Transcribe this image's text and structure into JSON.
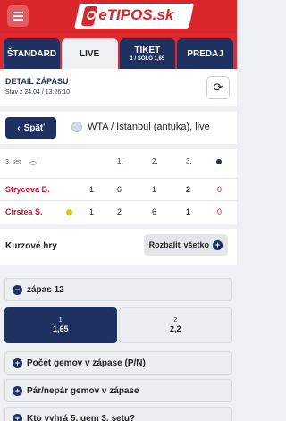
{
  "brand": {
    "logo_text": "eTIPOS.sk"
  },
  "tabs": [
    {
      "label": "ŠTANDARD",
      "sub": ""
    },
    {
      "label": "LIVE",
      "sub": ""
    },
    {
      "label": "TIKET",
      "sub": "1 / SOLO 1,65"
    },
    {
      "label": "PREDAJ",
      "sub": ""
    }
  ],
  "detail": {
    "title": "DETAIL ZÁPASU",
    "subtitle": "Stav z 24.04 / 13:26:10"
  },
  "event": {
    "back_label": "Späť",
    "title": "WTA / Istanbul (antuka), live"
  },
  "scoreboard": {
    "set_label": "3. set",
    "headers": [
      "1.",
      "2.",
      "3."
    ],
    "players": [
      {
        "name": "Strycova B.",
        "games": "1",
        "set1": "6",
        "set2": "1",
        "set3": "2",
        "points": "0",
        "serving": false
      },
      {
        "name": "Cirstea S.",
        "games": "1",
        "set1": "2",
        "set2": "6",
        "set3": "1",
        "points": "0",
        "serving": true
      }
    ]
  },
  "odds": {
    "title": "Kurzové hry",
    "expand_all_label": "Rozbaliť všetko",
    "markets": [
      {
        "label": "zápas 12",
        "expanded": true
      },
      {
        "label": "Počet gemov v zápase (P/N)",
        "expanded": false
      },
      {
        "label": "Pár/nepár gemov v zápase",
        "expanded": false
      },
      {
        "label": "Kto vyhrá 5. gem 3. setu?",
        "expanded": false
      }
    ],
    "outcomes": [
      {
        "name": "1",
        "odd": "1,65",
        "selected": true
      },
      {
        "name": "2",
        "odd": "2,2",
        "selected": false
      }
    ]
  },
  "colors": {
    "brand_red": "#d9262b",
    "navy": "#1f3160",
    "player_red": "#c8102e"
  }
}
